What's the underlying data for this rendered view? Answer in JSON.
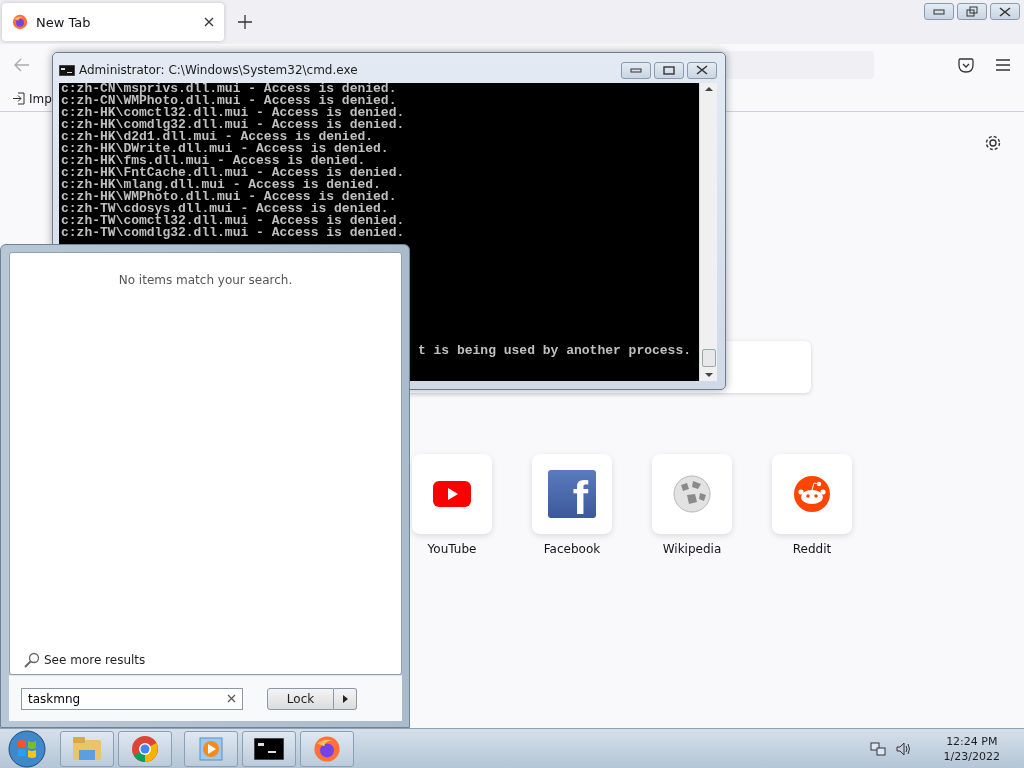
{
  "browser": {
    "tabs": [
      {
        "title": "New Tab",
        "selected": true
      }
    ],
    "bookmarks": [
      {
        "label": "Imp"
      }
    ],
    "top_sites": [
      {
        "label": "YouTube",
        "kind": "video"
      },
      {
        "label": "Facebook",
        "kind": "letter",
        "logo": "f"
      },
      {
        "label": "Wikipedia",
        "kind": "globe"
      },
      {
        "label": "Reddit",
        "kind": "mascot"
      }
    ]
  },
  "console_window": {
    "title": "Administrator: C:\\Windows\\System32\\cmd.exe",
    "lines": [
      "c:zh-CN\\msprivs.dll.mui - Access is denied.",
      "c:zh-CN\\WMPhoto.dll.mui - Access is denied.",
      "c:zh-HK\\comctl32.dll.mui - Access is denied.",
      "c:zh-HK\\comdlg32.dll.mui - Access is denied.",
      "c:zh-HK\\d2d1.dll.mui - Access is denied.",
      "c:zh-HK\\DWrite.dll.mui - Access is denied.",
      "c:zh-HK\\fms.dll.mui - Access is denied.",
      "c:zh-HK\\FntCache.dll.mui - Access is denied.",
      "c:zh-HK\\mlang.dll.mui - Access is denied.",
      "c:zh-HK\\WMPhoto.dll.mui - Access is denied.",
      "c:zh-TW\\cdosys.dll.mui - Access is denied.",
      "c:zh-TW\\comctl32.dll.mui - Access is denied.",
      "c:zh-TW\\comdlg32.dll.mui - Access is denied."
    ],
    "last_line": "t is being used by another process."
  },
  "start_menu": {
    "message": "No items match your search.",
    "see_more": "See more results",
    "search": {
      "value": "taskmng"
    },
    "power_button": "Lock"
  },
  "taskbar": {
    "clock": {
      "time": "12:24 PM",
      "date": "1/23/2022"
    }
  }
}
